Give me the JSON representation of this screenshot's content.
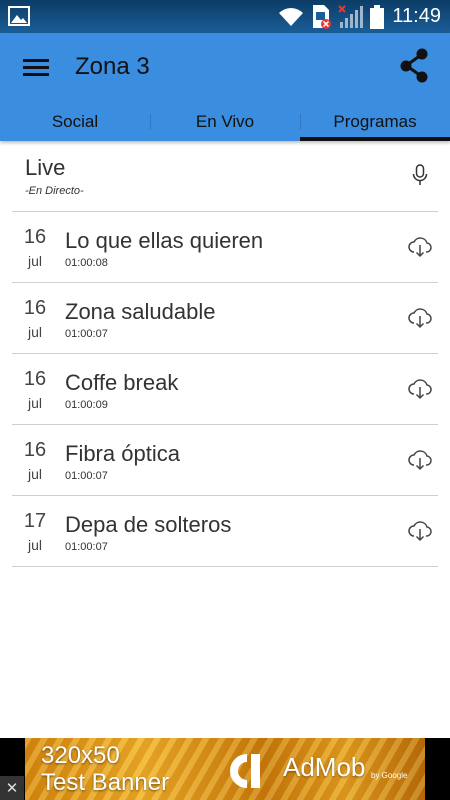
{
  "status_bar": {
    "time": "11:49",
    "icons": [
      "image-notification-icon",
      "wifi-icon",
      "sim-error-icon",
      "signal-icon",
      "battery-icon"
    ]
  },
  "app_bar": {
    "title": "Zona 3",
    "menu_icon": "hamburger-menu-icon",
    "share_icon": "share-icon",
    "color": "#3b8de0"
  },
  "tabs": [
    {
      "label": "Social",
      "active": false
    },
    {
      "label": "En Vivo",
      "active": false
    },
    {
      "label": "Programas",
      "active": true
    }
  ],
  "live": {
    "title": "Live",
    "subtitle": "-En Directo-",
    "icon": "microphone-icon"
  },
  "programs": [
    {
      "day": "16",
      "month": "jul",
      "title": "Lo que ellas quieren",
      "duration": "01:00:08"
    },
    {
      "day": "16",
      "month": "jul",
      "title": "Zona saludable",
      "duration": "01:00:07"
    },
    {
      "day": "16",
      "month": "jul",
      "title": "Coffe break",
      "duration": "01:00:09"
    },
    {
      "day": "16",
      "month": "jul",
      "title": "Fibra óptica",
      "duration": "01:00:07"
    },
    {
      "day": "17",
      "month": "jul",
      "title": "Depa de solteros",
      "duration": "01:00:07"
    }
  ],
  "ad": {
    "line1": "320x50",
    "line2": "Test Banner",
    "brand": "AdMob",
    "by": "by Google",
    "close": "✕"
  }
}
